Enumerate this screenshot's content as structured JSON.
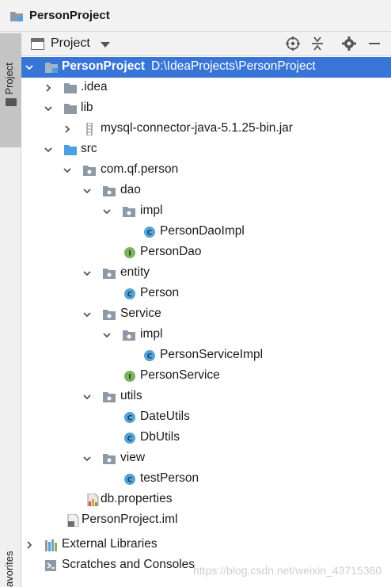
{
  "window": {
    "title": "PersonProject"
  },
  "sidebar": {
    "tab_label": "1: Project",
    "bottom_label": "avorites"
  },
  "panel": {
    "view_label": "Project"
  },
  "tree": [
    {
      "label": "PersonProject",
      "path": "D:\\IdeaProjects\\PersonProject",
      "icon": "project-folder-icon",
      "expanded": true
    },
    {
      "label": ".idea",
      "icon": "folder-icon",
      "expanded": false
    },
    {
      "label": "lib",
      "icon": "folder-icon",
      "expanded": true
    },
    {
      "label": "mysql-connector-java-5.1.25-bin.jar",
      "icon": "jar-icon",
      "expanded": false
    },
    {
      "label": "src",
      "icon": "source-folder-icon",
      "expanded": true
    },
    {
      "label": "com.qf.person",
      "icon": "package-icon",
      "expanded": true
    },
    {
      "label": "dao",
      "icon": "package-icon",
      "expanded": true
    },
    {
      "label": "impl",
      "icon": "package-icon",
      "expanded": true
    },
    {
      "label": "PersonDaoImpl",
      "icon": "class-icon"
    },
    {
      "label": "PersonDao",
      "icon": "interface-icon"
    },
    {
      "label": "entity",
      "icon": "package-icon",
      "expanded": true
    },
    {
      "label": "Person",
      "icon": "class-icon"
    },
    {
      "label": "Service",
      "icon": "package-icon",
      "expanded": true
    },
    {
      "label": "impl",
      "icon": "package-icon",
      "expanded": true
    },
    {
      "label": "PersonServiceImpl",
      "icon": "class-icon"
    },
    {
      "label": "PersonService",
      "icon": "interface-icon"
    },
    {
      "label": "utils",
      "icon": "package-icon",
      "expanded": true
    },
    {
      "label": "DateUtils",
      "icon": "class-icon"
    },
    {
      "label": "DbUtils",
      "icon": "class-icon"
    },
    {
      "label": "view",
      "icon": "package-icon",
      "expanded": true
    },
    {
      "label": "testPerson",
      "icon": "class-icon"
    },
    {
      "label": "db.properties",
      "icon": "properties-file-icon"
    },
    {
      "label": "PersonProject.iml",
      "icon": "iml-file-icon"
    },
    {
      "label": "External Libraries",
      "icon": "libraries-icon",
      "expanded": false
    },
    {
      "label": "Scratches and Consoles",
      "icon": "scratches-icon"
    }
  ],
  "watermark": "https://blog.csdn.net/weixin_43715360",
  "colors": {
    "selection": "#3875d6",
    "class_icon": "#54a3d6",
    "interface_icon": "#7bb35e",
    "folder": "#8d9aa6",
    "source_folder": "#4e9fe0"
  }
}
